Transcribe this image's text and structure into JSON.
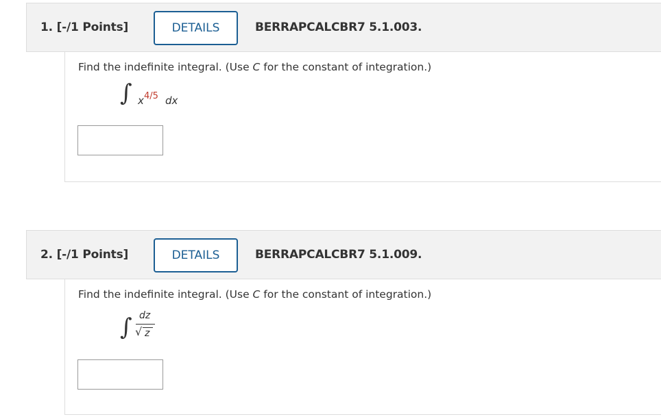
{
  "questions": [
    {
      "points_label": "1. [-/1 Points]",
      "details_label": "DETAILS",
      "code": "BERRAPCALCBR7 5.1.003.",
      "prompt_before": "Find the indefinite integral. (Use ",
      "prompt_var": "C",
      "prompt_after": " for the constant of integration.)",
      "integral_symbol": "∫",
      "integrand_base": "x",
      "integrand_exponent": "4/5",
      "differential": "dx",
      "answer_value": ""
    },
    {
      "points_label": "2. [-/1 Points]",
      "details_label": "DETAILS",
      "code": "BERRAPCALCBR7 5.1.009.",
      "prompt_before": "Find the indefinite integral. (Use ",
      "prompt_var": "C",
      "prompt_after": " for the constant of integration.)",
      "integral_symbol": "∫",
      "numerator": "dz",
      "radical_symbol": "√",
      "radicand": "z",
      "answer_value": ""
    }
  ],
  "colors": {
    "header_bg": "#f2f2f2",
    "border": "#dddddd",
    "details_blue": "#1b5e93",
    "exponent_red": "#c0392b",
    "text": "#333333"
  }
}
